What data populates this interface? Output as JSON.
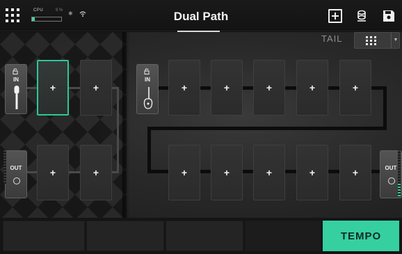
{
  "status": {
    "cpu_label": "CPU",
    "cpu_percent": "9 %",
    "cpu_level": 0.09,
    "bluetooth_icon": "bluetooth-icon",
    "wifi_icon": "wifi-icon"
  },
  "header": {
    "title": "Dual Path",
    "menu_icon": "grid-menu-icon",
    "add_icon": "add-block-icon",
    "tuner_icon": "tuner-icon",
    "save_icon": "save-icon"
  },
  "tail": {
    "label": "TAIL",
    "icon": "grid-icon"
  },
  "paths": {
    "input_1_label": "IN",
    "input_2_label": "IN",
    "output_1_label": "OUT",
    "output_2_label": "OUT",
    "slot_glyph": "+"
  },
  "footer": {
    "tempo_label": "TEMPO"
  },
  "colors": {
    "accent": "#36cfa0",
    "background": "#0e0e0e"
  }
}
